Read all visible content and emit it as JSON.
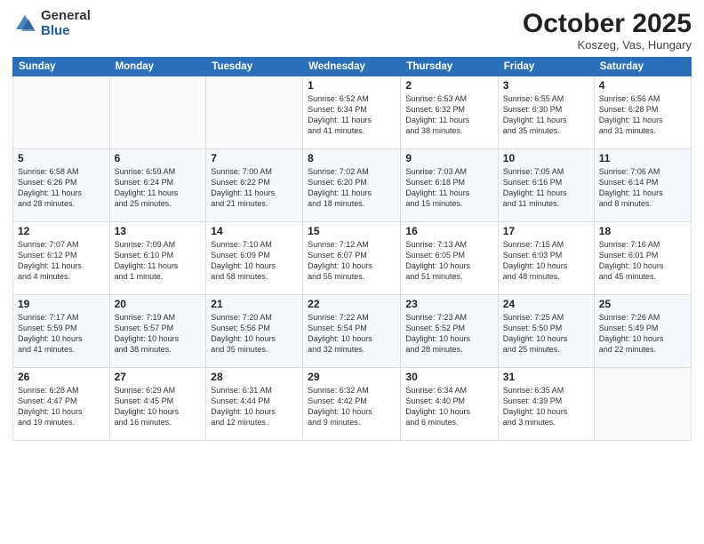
{
  "header": {
    "logo_general": "General",
    "logo_blue": "Blue",
    "month_title": "October 2025",
    "location": "Koszeg, Vas, Hungary"
  },
  "weekdays": [
    "Sunday",
    "Monday",
    "Tuesday",
    "Wednesday",
    "Thursday",
    "Friday",
    "Saturday"
  ],
  "weeks": [
    [
      {
        "day": "",
        "info": ""
      },
      {
        "day": "",
        "info": ""
      },
      {
        "day": "",
        "info": ""
      },
      {
        "day": "1",
        "info": "Sunrise: 6:52 AM\nSunset: 6:34 PM\nDaylight: 11 hours\nand 41 minutes."
      },
      {
        "day": "2",
        "info": "Sunrise: 6:53 AM\nSunset: 6:32 PM\nDaylight: 11 hours\nand 38 minutes."
      },
      {
        "day": "3",
        "info": "Sunrise: 6:55 AM\nSunset: 6:30 PM\nDaylight: 11 hours\nand 35 minutes."
      },
      {
        "day": "4",
        "info": "Sunrise: 6:56 AM\nSunset: 6:28 PM\nDaylight: 11 hours\nand 31 minutes."
      }
    ],
    [
      {
        "day": "5",
        "info": "Sunrise: 6:58 AM\nSunset: 6:26 PM\nDaylight: 11 hours\nand 28 minutes."
      },
      {
        "day": "6",
        "info": "Sunrise: 6:59 AM\nSunset: 6:24 PM\nDaylight: 11 hours\nand 25 minutes."
      },
      {
        "day": "7",
        "info": "Sunrise: 7:00 AM\nSunset: 6:22 PM\nDaylight: 11 hours\nand 21 minutes."
      },
      {
        "day": "8",
        "info": "Sunrise: 7:02 AM\nSunset: 6:20 PM\nDaylight: 11 hours\nand 18 minutes."
      },
      {
        "day": "9",
        "info": "Sunrise: 7:03 AM\nSunset: 6:18 PM\nDaylight: 11 hours\nand 15 minutes."
      },
      {
        "day": "10",
        "info": "Sunrise: 7:05 AM\nSunset: 6:16 PM\nDaylight: 11 hours\nand 11 minutes."
      },
      {
        "day": "11",
        "info": "Sunrise: 7:06 AM\nSunset: 6:14 PM\nDaylight: 11 hours\nand 8 minutes."
      }
    ],
    [
      {
        "day": "12",
        "info": "Sunrise: 7:07 AM\nSunset: 6:12 PM\nDaylight: 11 hours\nand 4 minutes."
      },
      {
        "day": "13",
        "info": "Sunrise: 7:09 AM\nSunset: 6:10 PM\nDaylight: 11 hours\nand 1 minute."
      },
      {
        "day": "14",
        "info": "Sunrise: 7:10 AM\nSunset: 6:09 PM\nDaylight: 10 hours\nand 58 minutes."
      },
      {
        "day": "15",
        "info": "Sunrise: 7:12 AM\nSunset: 6:07 PM\nDaylight: 10 hours\nand 55 minutes."
      },
      {
        "day": "16",
        "info": "Sunrise: 7:13 AM\nSunset: 6:05 PM\nDaylight: 10 hours\nand 51 minutes."
      },
      {
        "day": "17",
        "info": "Sunrise: 7:15 AM\nSunset: 6:03 PM\nDaylight: 10 hours\nand 48 minutes."
      },
      {
        "day": "18",
        "info": "Sunrise: 7:16 AM\nSunset: 6:01 PM\nDaylight: 10 hours\nand 45 minutes."
      }
    ],
    [
      {
        "day": "19",
        "info": "Sunrise: 7:17 AM\nSunset: 5:59 PM\nDaylight: 10 hours\nand 41 minutes."
      },
      {
        "day": "20",
        "info": "Sunrise: 7:19 AM\nSunset: 5:57 PM\nDaylight: 10 hours\nand 38 minutes."
      },
      {
        "day": "21",
        "info": "Sunrise: 7:20 AM\nSunset: 5:56 PM\nDaylight: 10 hours\nand 35 minutes."
      },
      {
        "day": "22",
        "info": "Sunrise: 7:22 AM\nSunset: 5:54 PM\nDaylight: 10 hours\nand 32 minutes."
      },
      {
        "day": "23",
        "info": "Sunrise: 7:23 AM\nSunset: 5:52 PM\nDaylight: 10 hours\nand 28 minutes."
      },
      {
        "day": "24",
        "info": "Sunrise: 7:25 AM\nSunset: 5:50 PM\nDaylight: 10 hours\nand 25 minutes."
      },
      {
        "day": "25",
        "info": "Sunrise: 7:26 AM\nSunset: 5:49 PM\nDaylight: 10 hours\nand 22 minutes."
      }
    ],
    [
      {
        "day": "26",
        "info": "Sunrise: 6:28 AM\nSunset: 4:47 PM\nDaylight: 10 hours\nand 19 minutes."
      },
      {
        "day": "27",
        "info": "Sunrise: 6:29 AM\nSunset: 4:45 PM\nDaylight: 10 hours\nand 16 minutes."
      },
      {
        "day": "28",
        "info": "Sunrise: 6:31 AM\nSunset: 4:44 PM\nDaylight: 10 hours\nand 12 minutes."
      },
      {
        "day": "29",
        "info": "Sunrise: 6:32 AM\nSunset: 4:42 PM\nDaylight: 10 hours\nand 9 minutes."
      },
      {
        "day": "30",
        "info": "Sunrise: 6:34 AM\nSunset: 4:40 PM\nDaylight: 10 hours\nand 6 minutes."
      },
      {
        "day": "31",
        "info": "Sunrise: 6:35 AM\nSunset: 4:39 PM\nDaylight: 10 hours\nand 3 minutes."
      },
      {
        "day": "",
        "info": ""
      }
    ]
  ]
}
